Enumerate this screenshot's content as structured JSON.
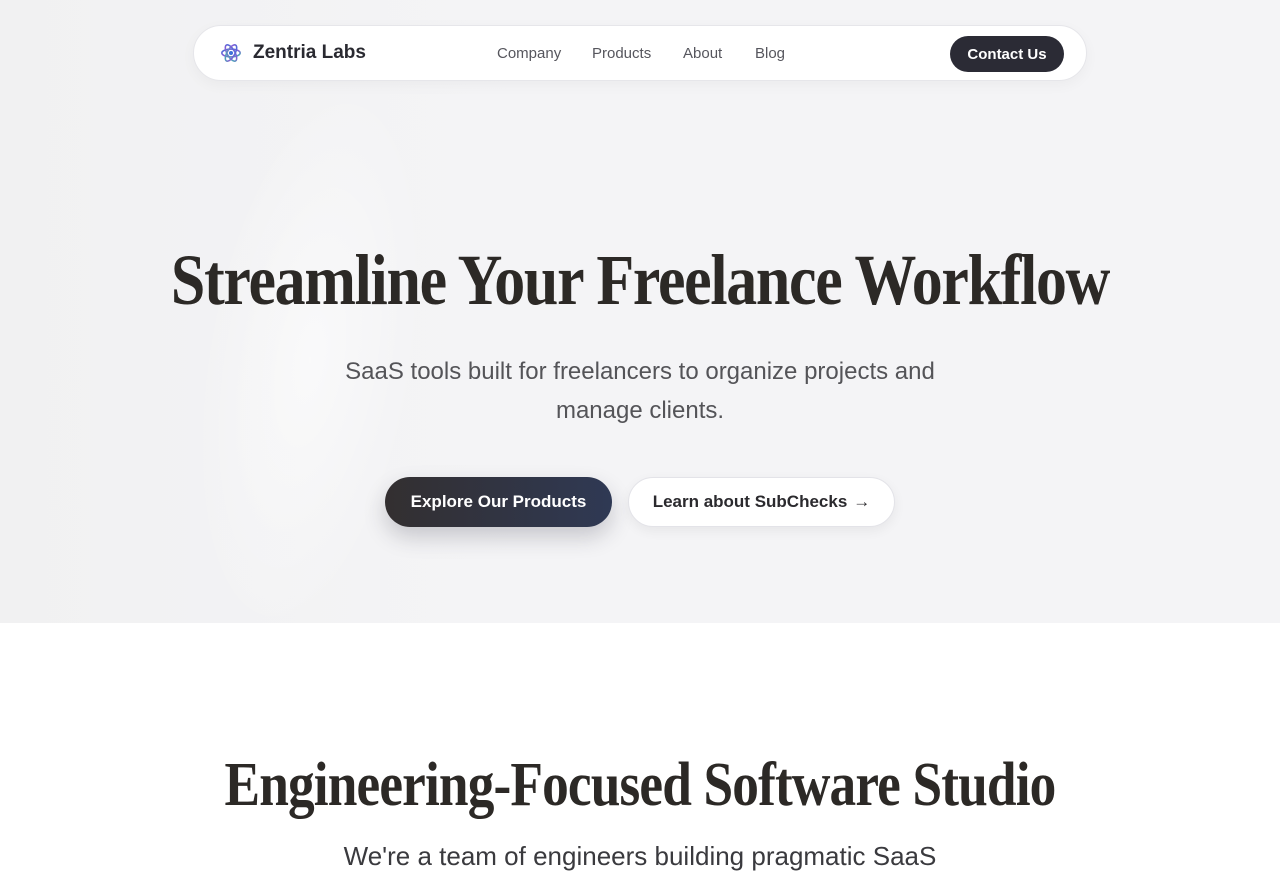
{
  "navbar": {
    "brand": "Zentria Labs",
    "brand_icon": "atom-logo-icon",
    "links": [
      "Company",
      "Products",
      "About",
      "Blog"
    ],
    "contact_label": "Contact Us"
  },
  "hero": {
    "title": "Streamline Your Freelance Workflow",
    "subtitle": "SaaS tools built for freelancers to organize projects and manage clients.",
    "primary_cta": "Explore Our Products",
    "secondary_cta": "Learn about SubChecks",
    "secondary_cta_arrow": "→"
  },
  "section": {
    "title": "Engineering-Focused Software Studio",
    "subtitle": "We're a team of engineers building pragmatic SaaS"
  },
  "colors": {
    "dark": "#2b2b35",
    "primary_gradient_start": "#332f30",
    "primary_gradient_end": "#2f3954",
    "hero_bg": "#f4f4f6",
    "logo_blue": "#3f6fd8",
    "logo_purple": "#8a5cd6",
    "logo_teal": "#3cb6b0"
  }
}
